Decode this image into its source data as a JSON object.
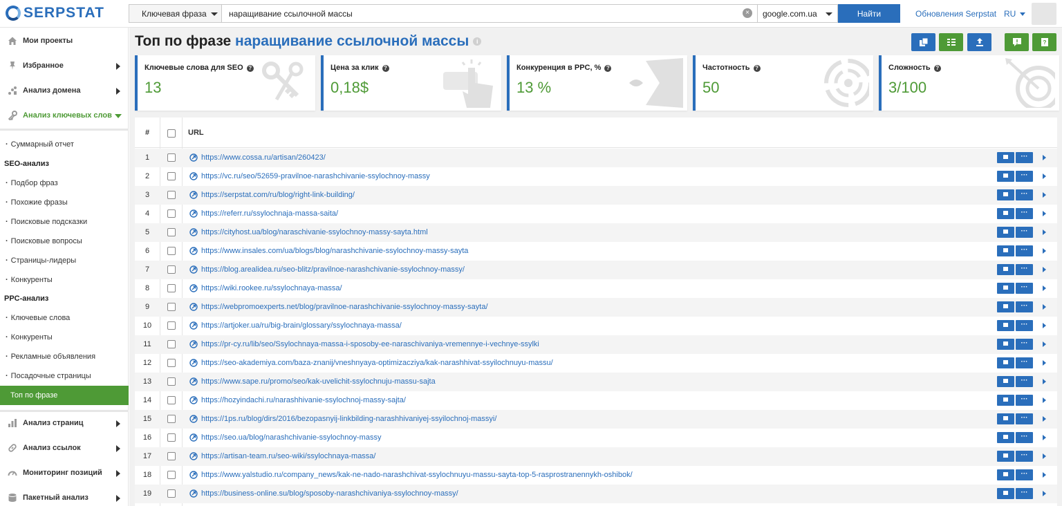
{
  "header": {
    "logo": "SERPSTAT",
    "search_type": "Ключевая фраза",
    "search_value": "наращивание ссылочной массы",
    "database": "google.com.ua",
    "find_button": "Найти",
    "updates_link": "Обновления Serpstat",
    "lang": "RU"
  },
  "sidebar": {
    "top_items": [
      {
        "label": "Мои проекты",
        "icon": "home-icon"
      },
      {
        "label": "Избранное",
        "icon": "pin-icon"
      },
      {
        "label": "Анализ домена",
        "icon": "chart-icon"
      },
      {
        "label": "Анализ ключевых слов",
        "icon": "key-icon"
      }
    ],
    "sub": {
      "summary": "Суммарный отчет",
      "seo_head": "SEO-анализ",
      "seo_items": [
        "Подбор фраз",
        "Похожие фразы",
        "Поисковые подсказки",
        "Поисковые вопросы",
        "Страницы-лидеры",
        "Конкуренты"
      ],
      "ppc_head": "PPC-анализ",
      "ppc_items": [
        "Ключевые слова",
        "Конкуренты",
        "Рекламные объявления",
        "Посадочные страницы",
        "Топ по фразе"
      ]
    },
    "bottom_items": [
      {
        "label": "Анализ страниц",
        "icon": "bar-chart-icon"
      },
      {
        "label": "Анализ ссылок",
        "icon": "link-icon"
      },
      {
        "label": "Мониторинг позиций",
        "icon": "gauge-icon"
      },
      {
        "label": "Пакетный анализ",
        "icon": "database-icon"
      }
    ]
  },
  "main": {
    "title_prefix": "Топ по фразе",
    "title_keyword": "наращивание ссылочной массы",
    "cards": [
      {
        "label": "Ключевые слова для SEO",
        "value": "13",
        "deco": "keys-icon"
      },
      {
        "label": "Цена за клик",
        "value": "0,18$",
        "deco": "hand-click-icon"
      },
      {
        "label": "Конкуренция в PPC, %",
        "value": "13 %",
        "deco": "fish-icon"
      },
      {
        "label": "Частотность",
        "value": "50",
        "deco": "target-circles-icon"
      },
      {
        "label": "Сложность",
        "value": "3/100",
        "deco": "target-arrow-icon"
      }
    ],
    "table": {
      "col_num": "#",
      "col_url": "URL",
      "rows": [
        {
          "n": "1",
          "url": "https://www.cossa.ru/artisan/260423/"
        },
        {
          "n": "2",
          "url": "https://vc.ru/seo/52659-pravilnoe-narashchivanie-ssylochnoy-massy"
        },
        {
          "n": "3",
          "url": "https://serpstat.com/ru/blog/right-link-building/"
        },
        {
          "n": "4",
          "url": "https://referr.ru/ssylochnaja-massa-saita/"
        },
        {
          "n": "5",
          "url": "https://cityhost.ua/blog/naraschivanie-ssylochnoy-massy-sayta.html"
        },
        {
          "n": "6",
          "url": "https://www.insales.com/ua/blogs/blog/narashchivanie-ssylochnoy-massy-sayta"
        },
        {
          "n": "7",
          "url": "https://blog.arealidea.ru/seo-blitz/pravilnoe-narashchivanie-ssylochnoy-massy/"
        },
        {
          "n": "8",
          "url": "https://wiki.rookee.ru/ssylochnaya-massa/"
        },
        {
          "n": "9",
          "url": "https://webpromoexperts.net/blog/pravilnoe-narashchivanie-ssylochnoy-massy-sayta/"
        },
        {
          "n": "10",
          "url": "https://artjoker.ua/ru/big-brain/glossary/ssylochnaya-massa/"
        },
        {
          "n": "11",
          "url": "https://pr-cy.ru/lib/seo/Ssylochnaya-massa-i-sposoby-ee-naraschivaniya-vremennye-i-vechnye-ssylki"
        },
        {
          "n": "12",
          "url": "https://seo-akademiya.com/baza-znanij/vneshnyaya-optimizacziya/kak-narashhivat-ssyilochnuyu-massu/"
        },
        {
          "n": "13",
          "url": "https://www.sape.ru/promo/seo/kak-uvelichit-ssylochnuju-massu-sajta"
        },
        {
          "n": "14",
          "url": "https://hozyindachi.ru/narashhivanie-ssylochnoj-massy-sajta/"
        },
        {
          "n": "15",
          "url": "https://1ps.ru/blog/dirs/2016/bezopasnyij-linkbilding-narashhivaniyej-ssyilochnoj-massyi/"
        },
        {
          "n": "16",
          "url": "https://seo.ua/blog/narashchivanie-ssylochnoy-massy"
        },
        {
          "n": "17",
          "url": "https://artisan-team.ru/seo-wiki/ssylochnaya-massa/"
        },
        {
          "n": "18",
          "url": "https://www.yalstudio.ru/company_news/kak-ne-nado-narashchivat-ssylochnuyu-massu-sayta-top-5-rasprostranennykh-oshibok/"
        },
        {
          "n": "19",
          "url": "https://business-online.su/blog/sposoby-narashchivaniya-ssylochnoy-massy/"
        }
      ]
    }
  },
  "colors": {
    "brand_blue": "#2a6ebb",
    "accent_green": "#4e9a36"
  }
}
